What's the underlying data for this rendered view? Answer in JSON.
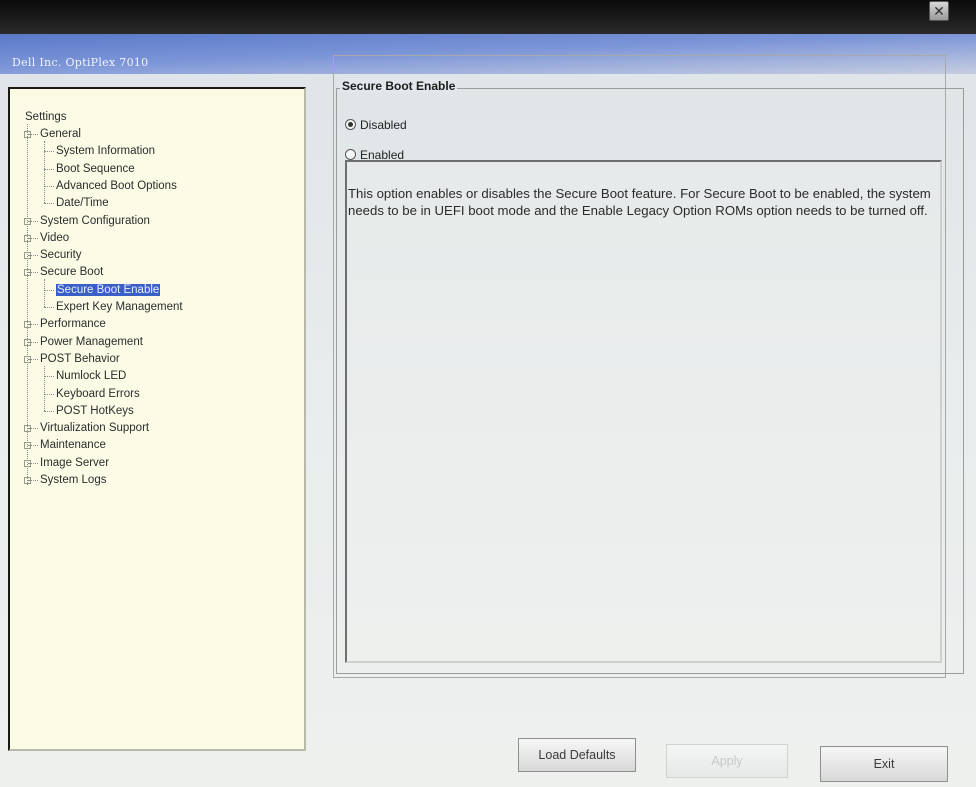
{
  "window": {
    "title": "Dell Inc. OptiPlex 7010",
    "close_glyph": "✕"
  },
  "tree": {
    "root": "Settings",
    "items": [
      {
        "label": "General",
        "level": 1,
        "expander": "−"
      },
      {
        "label": "System Information",
        "level": 2
      },
      {
        "label": "Boot Sequence",
        "level": 2
      },
      {
        "label": "Advanced Boot Options",
        "level": 2
      },
      {
        "label": "Date/Time",
        "level": 2
      },
      {
        "label": "System Configuration",
        "level": 1,
        "expander": "+"
      },
      {
        "label": "Video",
        "level": 1,
        "expander": "+"
      },
      {
        "label": "Security",
        "level": 1,
        "expander": "+"
      },
      {
        "label": "Secure Boot",
        "level": 1,
        "expander": "−"
      },
      {
        "label": "Secure Boot Enable",
        "level": 2,
        "selected": true
      },
      {
        "label": "Expert Key Management",
        "level": 2
      },
      {
        "label": "Performance",
        "level": 1,
        "expander": "+"
      },
      {
        "label": "Power Management",
        "level": 1,
        "expander": "+"
      },
      {
        "label": "POST Behavior",
        "level": 1,
        "expander": "−"
      },
      {
        "label": "Numlock LED",
        "level": 2
      },
      {
        "label": "Keyboard Errors",
        "level": 2
      },
      {
        "label": "POST HotKeys",
        "level": 2
      },
      {
        "label": "Virtualization Support",
        "level": 1,
        "expander": "+"
      },
      {
        "label": "Maintenance",
        "level": 1,
        "expander": "+"
      },
      {
        "label": "Image Server",
        "level": 1,
        "expander": "+"
      },
      {
        "label": "System Logs",
        "level": 1,
        "expander": "+"
      }
    ]
  },
  "section": {
    "title": "Secure Boot Enable",
    "options": [
      {
        "label": "Disabled",
        "selected": true
      },
      {
        "label": "Enabled",
        "selected": false
      }
    ],
    "description": "This option enables or disables the Secure Boot feature. For Secure Boot to be enabled, the system needs to be in UEFI boot mode and the Enable Legacy Option ROMs option needs to be turned off."
  },
  "buttons": {
    "load_defaults": "Load Defaults",
    "apply": "Apply",
    "exit": "Exit"
  },
  "icons": {
    "cursor": "mouse-pointer-icon"
  }
}
